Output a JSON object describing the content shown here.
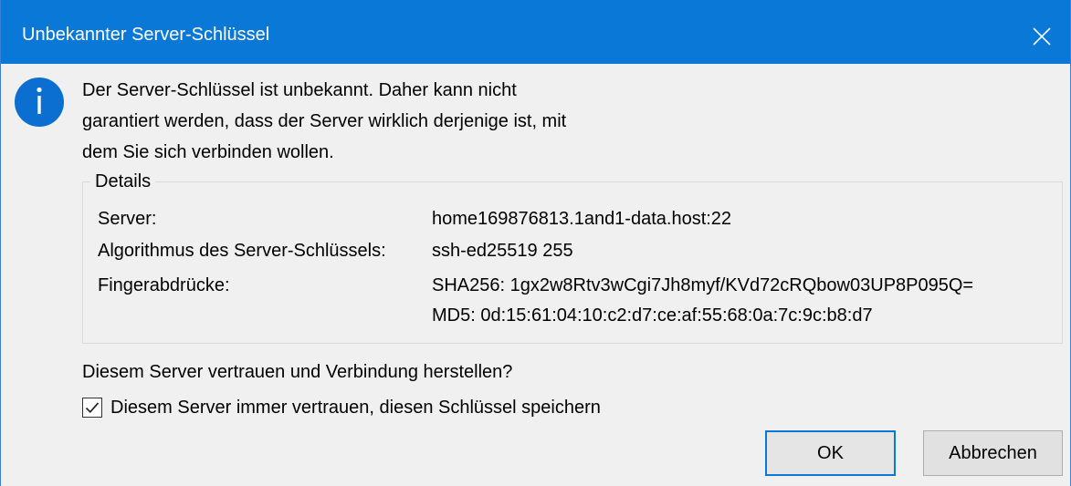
{
  "window": {
    "title": "Unbekannter Server-Schlüssel",
    "accent_color": "#0a78d7",
    "close_icon": "close-icon"
  },
  "message": {
    "icon": "info-icon",
    "lines": [
      "Der Server-Schlüssel ist unbekannt. Daher kann nicht",
      "garantiert werden, dass der Server wirklich derjenige ist, mit",
      "dem Sie sich verbinden wollen."
    ]
  },
  "details": {
    "legend": "Details",
    "server_label": "Server:",
    "server_value": "home169876813.1and1-data.host:22",
    "algorithm_label": "Algorithmus des Server-Schlüssels:",
    "algorithm_value": "ssh-ed25519 255",
    "fingerprints_label": "Fingerabdrücke:",
    "fingerprint_sha256": "SHA256: 1gx2w8Rtv3wCgi7Jh8myf/KVd72cRQbow03UP8P095Q=",
    "fingerprint_md5": "MD5: 0d:15:61:04:10:c2:d7:ce:af:55:68:0a:7c:9c:b8:d7"
  },
  "question": "Diesem Server vertrauen und Verbindung herstellen?",
  "checkbox": {
    "label": "Diesem Server immer vertrauen, diesen Schlüssel speichern",
    "checked": true
  },
  "buttons": {
    "ok_label": "OK",
    "cancel_label": "Abbrechen"
  }
}
